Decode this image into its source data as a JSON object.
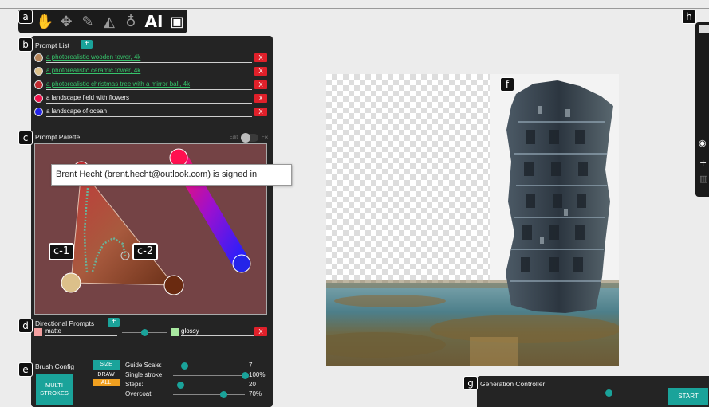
{
  "badges": {
    "a": "a",
    "b": "b",
    "c": "c",
    "d": "d",
    "e": "e",
    "f": "f",
    "g": "g",
    "h": "h",
    "c1": "c-1",
    "c2": "c-2"
  },
  "toolbar": {
    "tools": [
      "hand-icon",
      "move-icon",
      "brush-icon",
      "eraser-icon",
      "lasso-icon",
      "ai-icon",
      "save-icon"
    ],
    "ai_label": "AI"
  },
  "prompt_list": {
    "title": "Prompt List",
    "add_label": "+",
    "delete_label": "X",
    "items": [
      {
        "text": "a photorealistic wooden tower, 4k",
        "color": "#b7865b",
        "linked": true
      },
      {
        "text": "a photorealistic ceramic tower, 4k",
        "color": "#dcc08a",
        "linked": true
      },
      {
        "text": "a photorealistic christmas tree with a mirror ball, 4k",
        "color": "#c02a2f",
        "linked": true
      },
      {
        "text": "a landscape field with flowers",
        "color": "#f0104a",
        "linked": false
      },
      {
        "text": "a landscape of ocean",
        "color": "#2424e8",
        "linked": false
      }
    ]
  },
  "palette": {
    "title": "Prompt Palette",
    "toggle_left": "Edit",
    "toggle_right": "Fix",
    "tooltip": "Brent Hecht (brent.hecht@outlook.com) is signed in"
  },
  "directional": {
    "title": "Directional Prompts",
    "add_label": "+",
    "left_label": "matte",
    "right_label": "glossy",
    "left_color": "#f3a0a0",
    "right_color": "#a8e8a0",
    "delete_label": "X",
    "position": 0.5
  },
  "brush": {
    "title": "Brush Config",
    "multi_label": "MULTI\nSTROKES",
    "size_label": "SIZE",
    "draw_label": "DRAW",
    "all_label": "ALL",
    "sliders": [
      {
        "label": "Guide Scale:",
        "value": "7",
        "level": 0.15
      },
      {
        "label": "Single stroke:",
        "value": "100%",
        "level": 1.0
      },
      {
        "label": "Steps:",
        "value": "20",
        "level": 0.1
      },
      {
        "label": "Overcoat:",
        "value": "70%",
        "level": 0.7
      }
    ]
  },
  "generation": {
    "title": "Generation Controller",
    "start_label": "START",
    "level": 0.7
  },
  "colors": {
    "accent": "#1aa39a",
    "danger": "#e0202a",
    "panel": "#242424"
  }
}
